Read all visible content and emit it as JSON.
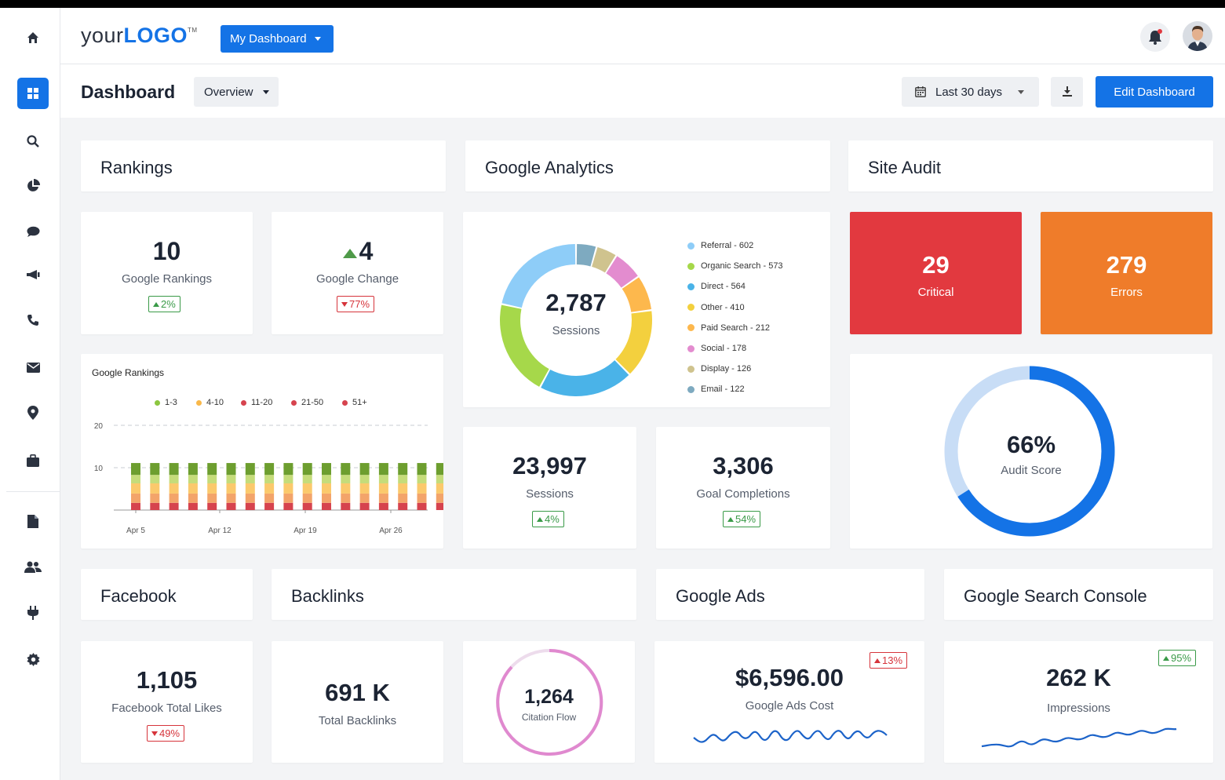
{
  "header": {
    "logo_light": "your",
    "logo_bold": "LOGO",
    "logo_tm": "TM",
    "dashboard_button": "My Dashboard"
  },
  "subbar": {
    "title": "Dashboard",
    "overview": "Overview",
    "date_range": "Last 30 days",
    "edit_button": "Edit Dashboard"
  },
  "sidebar": {
    "icons": [
      "home-icon",
      "dashboard-icon",
      "search-icon",
      "pie-chart-icon",
      "chat-icon",
      "megaphone-icon",
      "phone-icon",
      "mail-icon",
      "location-icon",
      "briefcase-icon",
      "document-icon",
      "users-icon",
      "plug-icon",
      "gear-icon"
    ],
    "active": "dashboard-icon"
  },
  "rankings": {
    "title": "Rankings",
    "google_rankings": {
      "value": "10",
      "label": "Google Rankings",
      "change": "2%",
      "direction": "up"
    },
    "google_change": {
      "value": "4",
      "label": "Google Change",
      "change": "77%",
      "direction": "down"
    },
    "chart": {
      "title": "Google Rankings",
      "legend": [
        "1-3",
        "4-10",
        "11-20",
        "21-50",
        "51+"
      ],
      "y_ticks": [
        "20",
        "10"
      ],
      "x_ticks": [
        "Apr 5",
        "Apr 12",
        "Apr 19",
        "Apr 26"
      ]
    }
  },
  "analytics": {
    "title": "Google Analytics",
    "sessions_total": "2,787",
    "sessions_label": "Sessions",
    "legend": [
      {
        "label": "Referral - 602",
        "color": "#8ecdf8"
      },
      {
        "label": "Organic Search - 573",
        "color": "#a6d84a"
      },
      {
        "label": "Direct - 564",
        "color": "#4ab3e8"
      },
      {
        "label": "Other - 410",
        "color": "#f3d03e"
      },
      {
        "label": "Paid Search - 212",
        "color": "#fdb84d"
      },
      {
        "label": "Social - 178",
        "color": "#e38ccf"
      },
      {
        "label": "Display - 126",
        "color": "#cfc38e"
      },
      {
        "label": "Email - 122",
        "color": "#7eaac0"
      }
    ],
    "sessions": {
      "value": "23,997",
      "label": "Sessions",
      "change": "4%"
    },
    "goals": {
      "value": "3,306",
      "label": "Goal Completions",
      "change": "54%"
    }
  },
  "site_audit": {
    "title": "Site Audit",
    "critical": {
      "value": "29",
      "label": "Critical"
    },
    "errors": {
      "value": "279",
      "label": "Errors"
    },
    "score": {
      "value": "66%",
      "label": "Audit Score"
    }
  },
  "facebook": {
    "title": "Facebook",
    "value": "1,105",
    "label": "Facebook Total Likes",
    "change": "49%"
  },
  "backlinks": {
    "title": "Backlinks",
    "total": {
      "value": "691 K",
      "label": "Total Backlinks"
    },
    "citation": {
      "value": "1,264",
      "label": "Citation Flow"
    }
  },
  "google_ads": {
    "title": "Google Ads",
    "value": "$6,596.00",
    "label": "Google Ads Cost",
    "change": "13%"
  },
  "search_console": {
    "title": "Google Search Console",
    "value": "262 K",
    "label": "Impressions",
    "change": "95%"
  },
  "chart_data": {
    "type": "bar",
    "title": "Google Rankings",
    "categories": [
      "",
      "",
      "",
      "",
      "",
      "",
      "",
      "",
      "",
      "",
      "",
      "",
      "",
      "",
      "",
      "",
      ""
    ],
    "x_tick_labels": [
      "Apr 5",
      "Apr 12",
      "Apr 19",
      "Apr 26"
    ],
    "stacked": true,
    "ylim": [
      0,
      20
    ],
    "y_ticks": [
      10,
      20
    ],
    "series": [
      {
        "name": "51+",
        "color": "#d6434e",
        "values": [
          1.7,
          1.7,
          1.7,
          1.7,
          1.7,
          1.7,
          1.7,
          1.7,
          1.7,
          1.7,
          1.7,
          1.7,
          1.7,
          1.7,
          1.7,
          1.7,
          1.7
        ]
      },
      {
        "name": "21-50",
        "color": "#f3a46a",
        "values": [
          2.2,
          2.2,
          2.2,
          2.2,
          2.2,
          2.2,
          2.2,
          2.2,
          2.2,
          2.2,
          2.2,
          2.2,
          2.2,
          2.2,
          2.2,
          2.2,
          2.2
        ]
      },
      {
        "name": "11-20",
        "color": "#fbc96c",
        "values": [
          2.4,
          2.4,
          2.4,
          2.4,
          2.4,
          2.4,
          2.4,
          2.4,
          2.4,
          2.4,
          2.4,
          2.4,
          2.4,
          2.4,
          2.4,
          2.4,
          2.4
        ]
      },
      {
        "name": "4-10",
        "color": "#c5dc7a",
        "values": [
          2.0,
          2.0,
          2.0,
          2.0,
          2.0,
          2.0,
          2.0,
          2.0,
          2.0,
          2.0,
          2.0,
          2.0,
          2.0,
          2.0,
          2.0,
          2.0,
          2.0
        ]
      },
      {
        "name": "1-3",
        "color": "#6d9e2f",
        "values": [
          2.8,
          2.8,
          2.8,
          2.8,
          2.8,
          2.8,
          2.8,
          2.8,
          2.8,
          2.8,
          2.8,
          2.8,
          2.8,
          2.8,
          2.8,
          2.8,
          2.8
        ]
      }
    ],
    "legend_position": "top",
    "grid": true
  }
}
